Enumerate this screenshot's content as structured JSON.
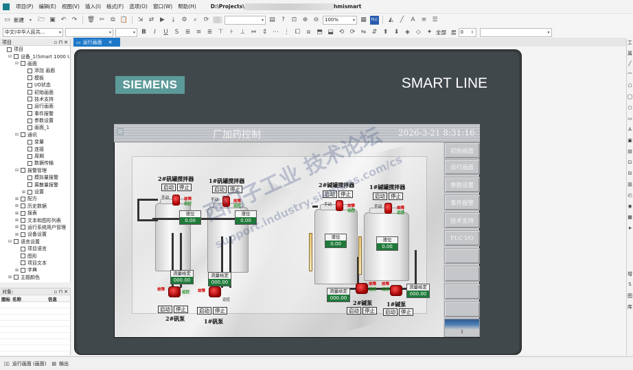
{
  "menubar": {
    "items": [
      "项目(P)",
      "编辑(E)",
      "视图(V)",
      "插入(I)",
      "格式(F)",
      "选项(O)",
      "窗口(W)",
      "帮助(H)"
    ],
    "path_prefix": "D:\\Projects\\",
    "path_suffix": "hmismart"
  },
  "toolbar1": {
    "new_label": "新建",
    "zoom_value": "100%"
  },
  "toolbar2": {
    "language_value": "中文(中华人民共...",
    "all_label": "全部",
    "layer_label": "层",
    "layer_value": "0"
  },
  "project_panel": {
    "title": "项目",
    "tree": [
      {
        "label": "项目",
        "indent": 0,
        "exp": ""
      },
      {
        "label": "设备_1(Smart 1000 I...",
        "indent": 1,
        "exp": "⊟"
      },
      {
        "label": "画面",
        "indent": 2,
        "exp": "⊟"
      },
      {
        "label": "添加 画面",
        "indent": 3,
        "exp": ""
      },
      {
        "label": "模板",
        "indent": 3,
        "exp": ""
      },
      {
        "label": "I/O状态",
        "indent": 3,
        "exp": ""
      },
      {
        "label": "初始画面",
        "indent": 3,
        "exp": ""
      },
      {
        "label": "技术支持",
        "indent": 3,
        "exp": ""
      },
      {
        "label": "运行画面",
        "indent": 3,
        "exp": ""
      },
      {
        "label": "事件报警",
        "indent": 3,
        "exp": ""
      },
      {
        "label": "参数设置",
        "indent": 3,
        "exp": ""
      },
      {
        "label": "画面_1",
        "indent": 3,
        "exp": ""
      },
      {
        "label": "通讯",
        "indent": 2,
        "exp": "⊟"
      },
      {
        "label": "变量",
        "indent": 3,
        "exp": ""
      },
      {
        "label": "连接",
        "indent": 3,
        "exp": ""
      },
      {
        "label": "周期",
        "indent": 3,
        "exp": ""
      },
      {
        "label": "数据传输",
        "indent": 3,
        "exp": ""
      },
      {
        "label": "报警管理",
        "indent": 2,
        "exp": "⊟"
      },
      {
        "label": "模拟量报警",
        "indent": 3,
        "exp": ""
      },
      {
        "label": "离散量报警",
        "indent": 3,
        "exp": ""
      },
      {
        "label": "设置",
        "indent": 3,
        "exp": "⊞"
      },
      {
        "label": "配方",
        "indent": 2,
        "exp": "⊞"
      },
      {
        "label": "历史数据",
        "indent": 2,
        "exp": "⊞"
      },
      {
        "label": "报表",
        "indent": 2,
        "exp": "⊞"
      },
      {
        "label": "文本和图形列表",
        "indent": 2,
        "exp": "⊞"
      },
      {
        "label": "运行系统用户管理",
        "indent": 2,
        "exp": "⊞"
      },
      {
        "label": "设备设置",
        "indent": 2,
        "exp": "⊞"
      },
      {
        "label": "语言设置",
        "indent": 1,
        "exp": "⊟"
      },
      {
        "label": "项目语言",
        "indent": 2,
        "exp": ""
      },
      {
        "label": "图形",
        "indent": 2,
        "exp": ""
      },
      {
        "label": "项目文本",
        "indent": 2,
        "exp": ""
      },
      {
        "label": "字典",
        "indent": 2,
        "exp": "⊞"
      },
      {
        "label": "主题颜色",
        "indent": 1,
        "exp": "⊞"
      }
    ]
  },
  "objects_panel": {
    "title": "对象:",
    "columns": [
      "图标",
      "名称",
      "信息"
    ]
  },
  "editor_tab": {
    "label": "运行画面",
    "close": "✕"
  },
  "device": {
    "brand": "SIEMENS",
    "model": "SMART LINE"
  },
  "hmi": {
    "title": "厂加药控制",
    "time": "2026-3-21 8:31:16",
    "nav": [
      "初始画面",
      "运行画面",
      "参数设置",
      "事件报警",
      "技术支持",
      "PLC I/O",
      "",
      "",
      "",
      ""
    ],
    "nav_bottom": "I",
    "mixer_labels": [
      "2#矾罐搅拌器",
      "1#矾罐搅拌器",
      "2#碱罐搅拌器",
      "1#碱罐搅拌器"
    ],
    "start": "启动",
    "stop": "停止",
    "manual": "手动",
    "fault": "故障",
    "remote": "远控",
    "level_caption": "液位",
    "level_value": "0.00",
    "flow_caption": "流量给定",
    "flow_value": "000.00",
    "pump_labels": [
      "2#矾泵",
      "1#矾泵",
      "2#碱泵",
      "1#碱泵"
    ]
  },
  "watermark": {
    "line1": "西门子工业  技术论坛",
    "line2": "support.industry.siemens.com/cs"
  },
  "statusbar": {
    "tab1": "运行画面 (画面)",
    "tab2": "输出"
  },
  "right_strip": {
    "labels": [
      "工",
      "属",
      "增",
      "S",
      "图",
      "库"
    ]
  }
}
